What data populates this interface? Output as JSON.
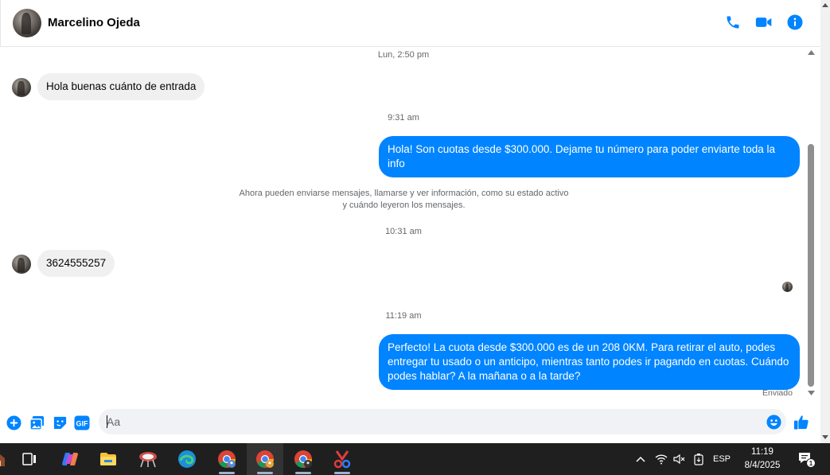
{
  "header": {
    "contact_name": "Marcelino Ojeda"
  },
  "colors": {
    "accent": "#0084ff",
    "incoming_bubble": "#f0f0f0",
    "meta_text": "#65676b"
  },
  "messages": {
    "timestamp_1": "Lun, 2:50 pm",
    "incoming_1": "Hola buenas cuánto de entrada",
    "timestamp_2": "9:31 am",
    "outgoing_1": "Hola! Son cuotas desde $300.000. Dejame tu número para poder enviarte toda la info",
    "notice_line_1": "Ahora pueden enviarse mensajes, llamarse y ver información, como su estado activo",
    "notice_line_2": "y cuándo leyeron los mensajes.",
    "timestamp_3": "10:31 am",
    "incoming_2": "3624555257",
    "timestamp_4": "11:19 am",
    "outgoing_2": "Perfecto! La cuota desde $300.000 es de un 208 0KM. Para retirar el auto, podes entregar tu usado o un anticipo, mientras tanto podes ir pagando en cuotas. Cuándo podes hablar? A la mañana o a la tarde?",
    "status": "Enviado"
  },
  "composer": {
    "placeholder": "Aa"
  },
  "taskbar": {
    "language": "ESP",
    "time": "11:19",
    "date": "8/4/2025",
    "notification_count": "1"
  }
}
